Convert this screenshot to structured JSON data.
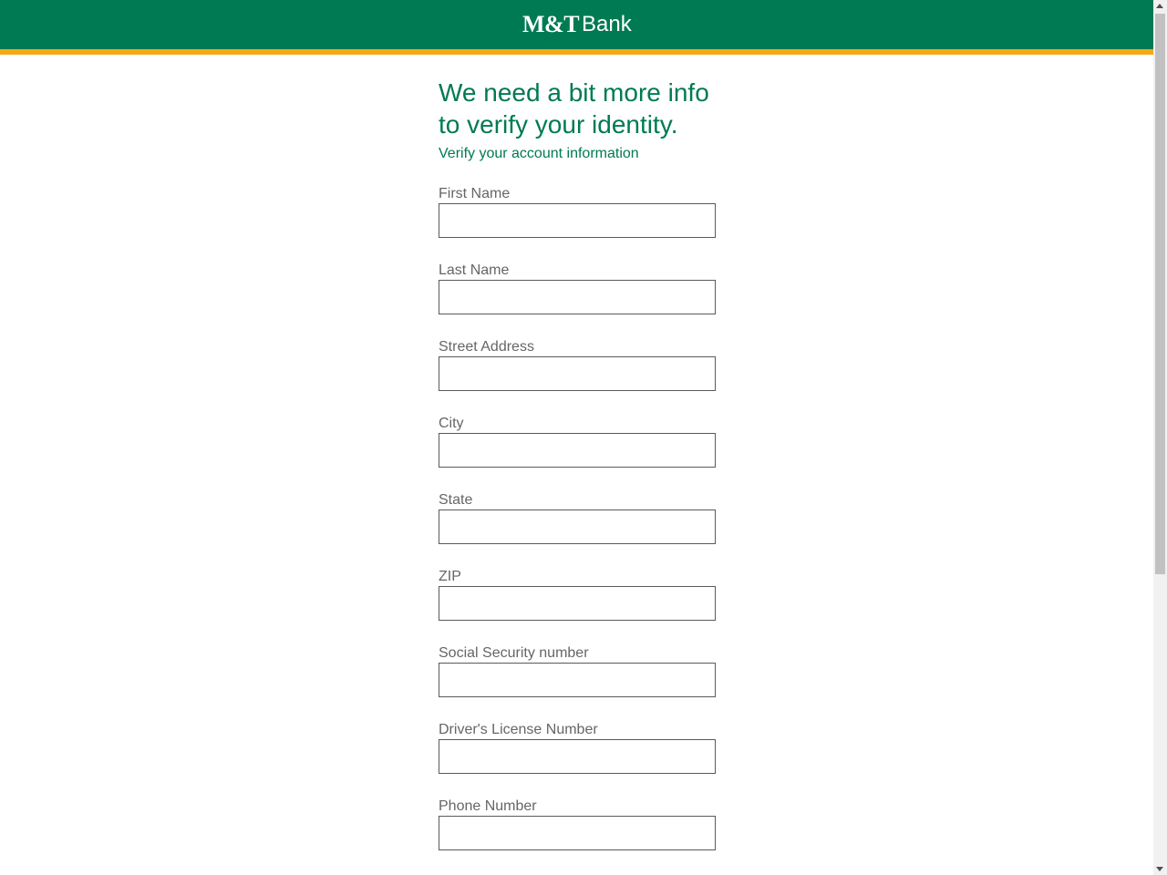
{
  "header": {
    "logo_mt": "M&T",
    "logo_bank": "Bank",
    "brand_color": "#007a53",
    "accent_color": "#f5a918"
  },
  "main": {
    "title_line1": "We need a bit more info",
    "title_line2": "to verify your identity.",
    "subtitle": "Verify your account information"
  },
  "form": {
    "fields": [
      {
        "label": "First Name",
        "value": ""
      },
      {
        "label": "Last Name",
        "value": ""
      },
      {
        "label": "Street Address",
        "value": ""
      },
      {
        "label": "City",
        "value": ""
      },
      {
        "label": "State",
        "value": ""
      },
      {
        "label": "ZIP",
        "value": ""
      },
      {
        "label": "Social Security number",
        "value": ""
      },
      {
        "label": "Driver's License Number",
        "value": ""
      },
      {
        "label": "Phone Number",
        "value": ""
      }
    ]
  }
}
